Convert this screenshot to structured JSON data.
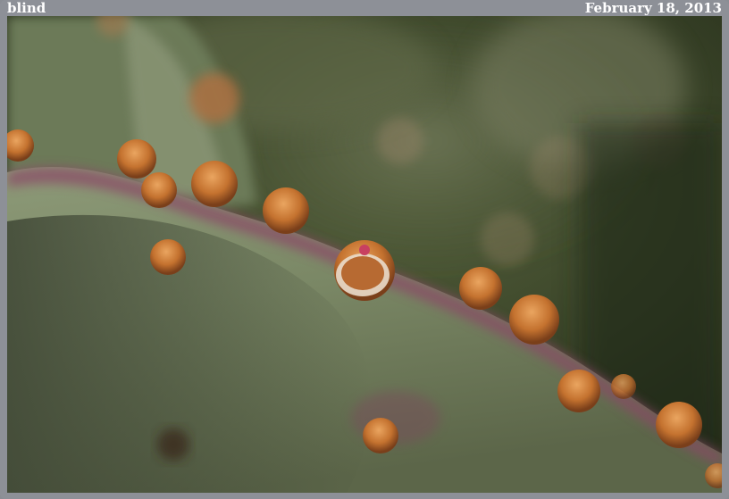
{
  "header": {
    "title": "blind",
    "date": "February 18, 2013"
  },
  "photo": {
    "subject": "prickly-pear-cactus-pad-closeup",
    "colors": {
      "background_dark": "#27301e",
      "background_mid": "#4a5636",
      "pad_green": "#7d8a6a",
      "pad_shadow": "#4d5641",
      "rim_purple": "#8a4a66",
      "areole_orange": "#c87a3a",
      "areole_light": "#e6a35e"
    }
  }
}
